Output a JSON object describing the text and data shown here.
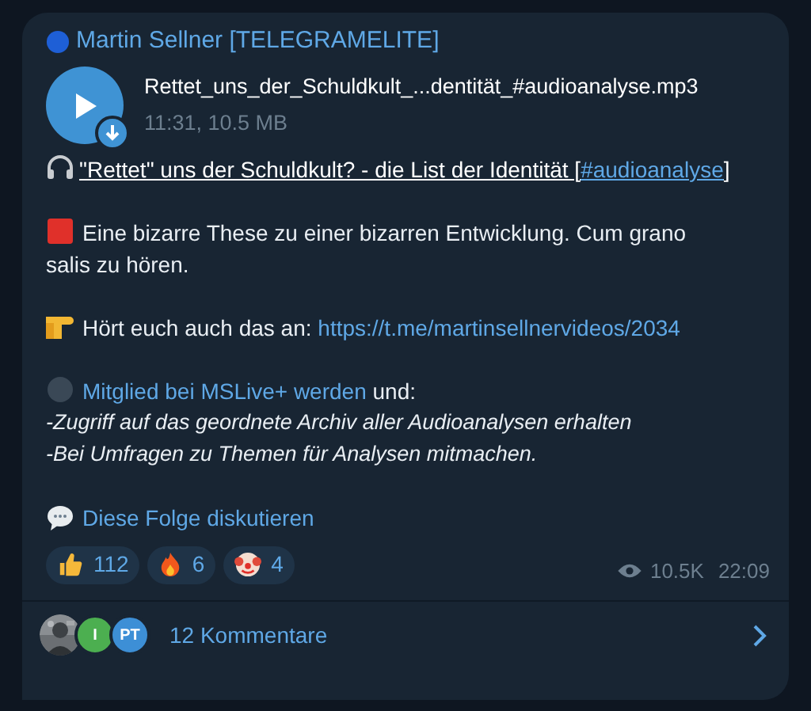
{
  "sender": {
    "name": "Martin Sellner [TELEGRAMELITE]"
  },
  "audio": {
    "file_name": "Rettet_uns_der_Schuldkult_...dentität_#audioanalyse.mp3",
    "meta": "11:31, 10.5 MB"
  },
  "title": {
    "text": "\"Rettet\" uns der Schuldkult? - die List der Identität [",
    "hashtag": "#audioanalyse",
    "suffix": "]"
  },
  "paragraphs": [
    {
      "kind": "plain",
      "text": "Eine bizarre These zu einer bizarren Entwicklung. Cum grano salis zu hören."
    },
    {
      "kind": "link",
      "text": "Hört euch auch das an:",
      "link": "https://t.me/martinsellnervideos/2034"
    },
    {
      "kind": "member",
      "link": "Mitglied bei MSLive+ werden",
      "text": "und:",
      "lines": [
        "-Zugriff auf das geordnete Archiv aller Audioanalysen erhalten",
        "-Bei Umfragen zu Themen für Analysen mitmachen."
      ]
    },
    {
      "kind": "discuss",
      "link": "Diese Folge diskutieren"
    }
  ],
  "reactions": [
    {
      "kind": "thumbs",
      "count": "112"
    },
    {
      "kind": "fire",
      "count": "6"
    },
    {
      "kind": "clown",
      "count": "4"
    }
  ],
  "views": "10.5K",
  "time": "22:09",
  "comments": {
    "avatars": [
      {
        "kind": "picture"
      },
      {
        "kind": "initials",
        "initials": "I",
        "color": "#4caf50"
      },
      {
        "kind": "initials",
        "initials": "PT",
        "color": "#3d8fd6"
      }
    ],
    "label": "12 Kommentare"
  }
}
